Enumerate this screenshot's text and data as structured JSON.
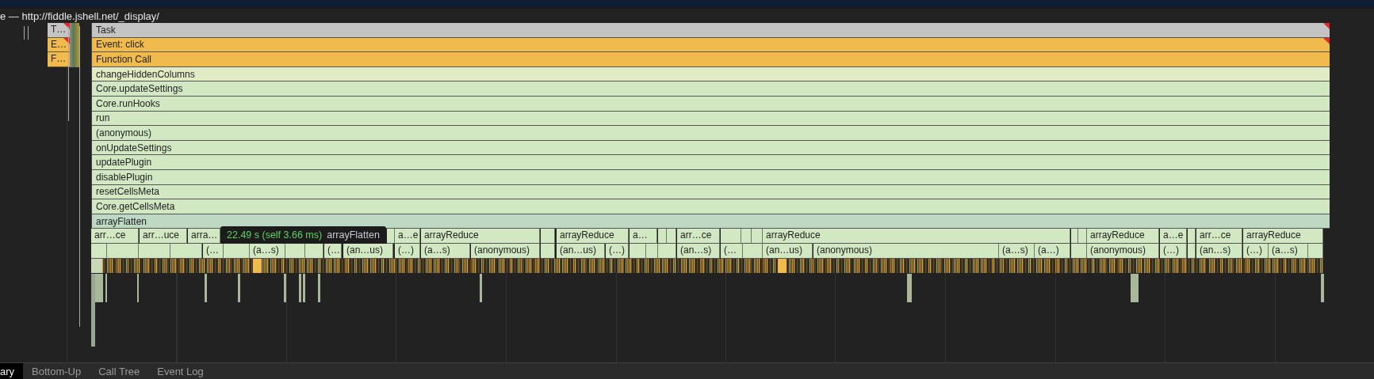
{
  "title": "e — http://fiddle.jshell.net/_display/",
  "mini_bars": [
    {
      "label": "T…",
      "color": "#c4c4c4",
      "warning": true
    },
    {
      "label": "E…",
      "color": "#f0bb4c",
      "warning": true
    },
    {
      "label": "F…",
      "color": "#f0bb4c",
      "warning": false
    }
  ],
  "rows": [
    {
      "label": "Task",
      "color": "#c4c4c4",
      "warning": true
    },
    {
      "label": "Event: click",
      "color": "#f0bb4c",
      "warning": true
    },
    {
      "label": "Function Call",
      "color": "#f0bb4c",
      "warning": false
    },
    {
      "label": "changeHiddenColumns",
      "color": "#e2ecc4",
      "warning": false
    },
    {
      "label": "Core.updateSettings",
      "color": "#d1e8c3",
      "warning": false
    },
    {
      "label": "Core.runHooks",
      "color": "#d1e8c3",
      "warning": false
    },
    {
      "label": "run",
      "color": "#d1e8c3",
      "warning": false
    },
    {
      "label": "(anonymous)",
      "color": "#d1e8c3",
      "warning": false
    },
    {
      "label": "onUpdateSettings",
      "color": "#d1e8c3",
      "warning": false
    },
    {
      "label": "updatePlugin",
      "color": "#d1e8c3",
      "warning": false
    },
    {
      "label": "disablePlugin",
      "color": "#d1e8c3",
      "warning": false
    },
    {
      "label": "resetCellsMeta",
      "color": "#d1e8c3",
      "warning": false
    },
    {
      "label": "Core.getCellsMeta",
      "color": "#d1e8c3",
      "warning": false
    },
    {
      "label": "arrayFlatten",
      "color": "#bdd9c3",
      "warning": false
    }
  ],
  "reduce_row": [
    "arr…ce",
    "arr…uce",
    "arra…",
    "a…e",
    "arrayReduce",
    "arrayReduce",
    "a…",
    "arr…ce",
    "arrayReduce",
    "arrayReduce",
    "a…e",
    "arr…ce",
    "arrayReduce"
  ],
  "anonymous_row": [
    "(…",
    "(a…s)",
    "(…",
    "(an…us)",
    "(…)",
    "(a…s)",
    "(anonymous)",
    "(an…us)",
    "(…)",
    "(an…s)",
    "(…",
    "(an…us)",
    "(anonymous)",
    "(a…s)",
    "(a…)",
    "(anonymous)",
    "(…)",
    "(an…s)",
    "(…)",
    "(a…s)"
  ],
  "tooltip": {
    "time": "22.49 s (self 3.66 ms)",
    "name": "arrayFlatten"
  },
  "tabs": [
    {
      "label": "ary",
      "selected": true
    },
    {
      "label": "Bottom-Up",
      "selected": false
    },
    {
      "label": "Call Tree",
      "selected": false
    },
    {
      "label": "Event Log",
      "selected": false
    }
  ]
}
